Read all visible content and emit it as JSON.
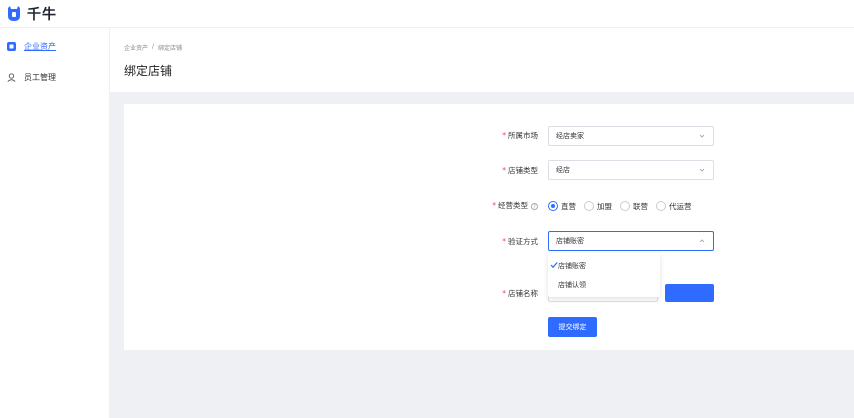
{
  "app": {
    "logo_text": "千牛"
  },
  "sidebar": {
    "items": [
      {
        "label": "企业资产",
        "active": true,
        "icon": "grid-icon"
      },
      {
        "label": "员工管理",
        "active": false,
        "icon": "user-icon"
      }
    ]
  },
  "breadcrumb": {
    "items": [
      "企业资产",
      "/",
      "绑定店铺"
    ]
  },
  "page": {
    "title": "绑定店铺"
  },
  "form": {
    "market": {
      "label": "所属市场",
      "required_mark": "*",
      "value": "经店卖家"
    },
    "shop_type": {
      "label": "店铺类型",
      "required_mark": "*",
      "value": "经店"
    },
    "biz_type": {
      "label": "经营类型",
      "required_mark": "*",
      "help_icon": "?",
      "options": [
        "直营",
        "加盟",
        "联营",
        "代运营"
      ],
      "selected": "直营"
    },
    "verify_method": {
      "label": "验证方式",
      "required_mark": "*",
      "value": "店铺账密"
    },
    "shop_name": {
      "label": "店铺名称",
      "required_mark": "*"
    },
    "dropdown_options": [
      "店铺账密",
      "店铺认领"
    ],
    "submit_label": "提交绑定"
  },
  "colors": {
    "accent": "#2f6bff",
    "required": "#f5455c",
    "background": "#eef0f4"
  }
}
